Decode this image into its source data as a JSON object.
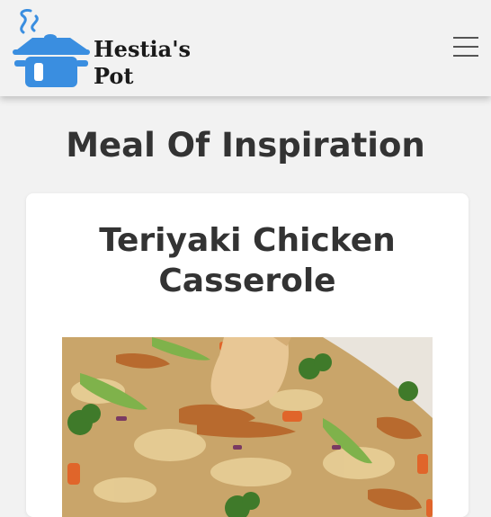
{
  "brand": {
    "name_line1": "Hestia's",
    "name_line2": "Pot",
    "icon": "cooking-pot-icon",
    "accent": "#3a8ee0"
  },
  "header": {
    "menu_icon": "hamburger-menu-icon"
  },
  "main": {
    "section_title": "Meal Of Inspiration",
    "meal": {
      "name": "Teriyaki Chicken Casserole",
      "photo_icon": "meal-photo"
    }
  }
}
